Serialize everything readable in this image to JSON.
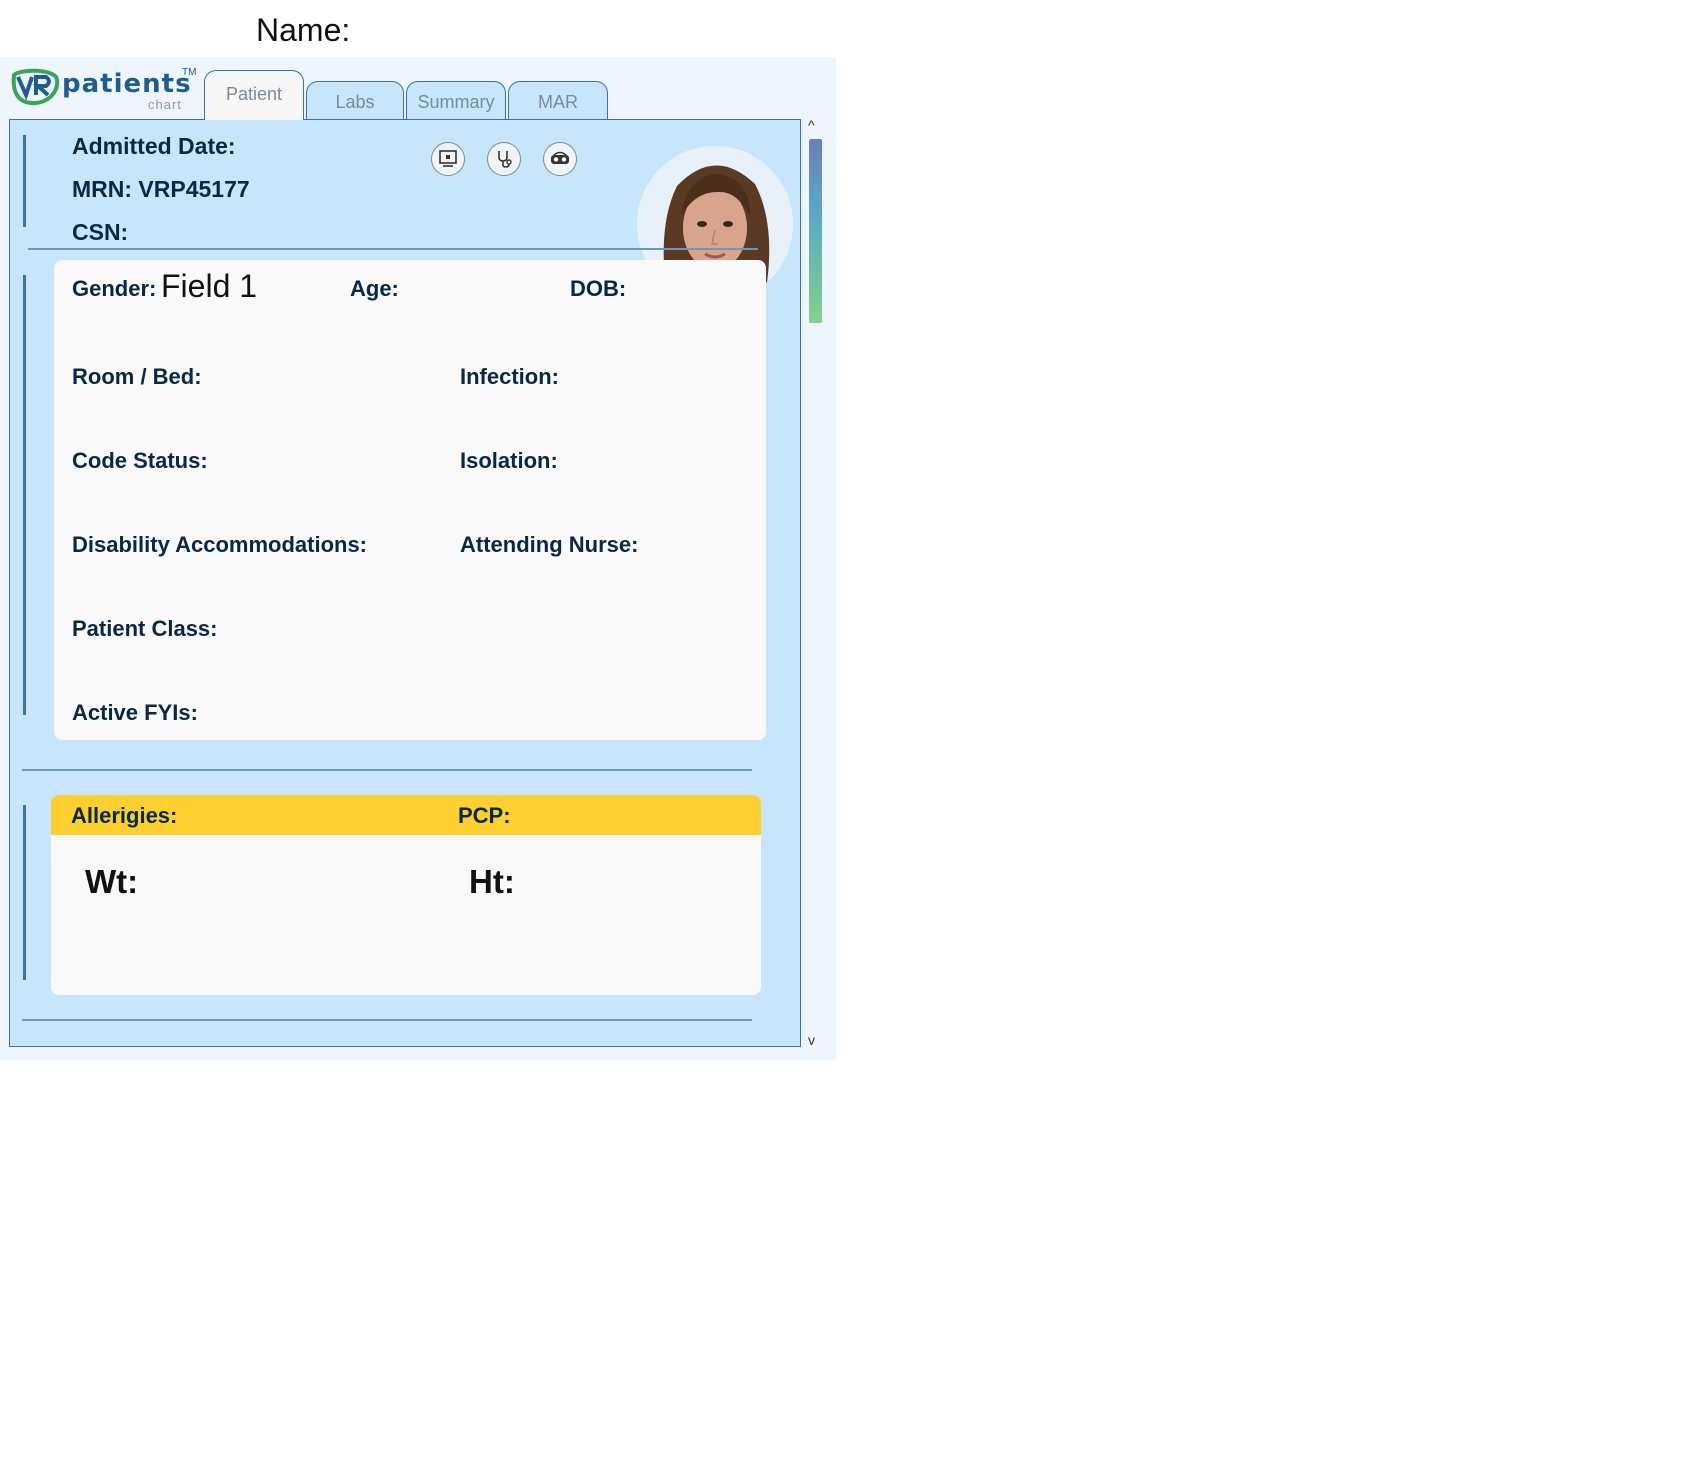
{
  "page": {
    "name_label": "Name:"
  },
  "logo": {
    "brand": "patients",
    "sub": "chart",
    "tm": "TM"
  },
  "tabs": [
    {
      "label": "Patient",
      "active": true
    },
    {
      "label": "Labs",
      "active": false
    },
    {
      "label": "Summary",
      "active": false
    },
    {
      "label": "MAR",
      "active": false
    }
  ],
  "header": {
    "admitted": "Admitted Date:",
    "mrn": "MRN: VRP45177",
    "csn": "CSN:"
  },
  "icons": [
    "monitor-icon",
    "stethoscope-icon",
    "vr-headset-icon",
    "sticky-note-icon"
  ],
  "details": {
    "gender_label": "Gender:",
    "gender_value": "Field 1",
    "age_label": "Age:",
    "dob_label": "DOB:",
    "room_label": "Room / Bed:",
    "infection_label": "Infection:",
    "code_status_label": "Code Status:",
    "isolation_label": "Isolation:",
    "disability_label": "Disability Accommodations:",
    "attending_label": "Attending Nurse:",
    "patient_class_label": "Patient Class:",
    "fyi_label": "Active FYIs:"
  },
  "allergy_bar": {
    "allergies_label": "Allerigies:",
    "pcp_label": "PCP:",
    "color": "#fbd02f"
  },
  "vitals": {
    "wt_label": "Wt:",
    "ht_label": "Ht:"
  },
  "scroll": {
    "up": "^",
    "down": "v"
  },
  "colors": {
    "panel_bg": "#c7e6fb",
    "border": "#3d6fa8",
    "text": "#0a2743"
  }
}
